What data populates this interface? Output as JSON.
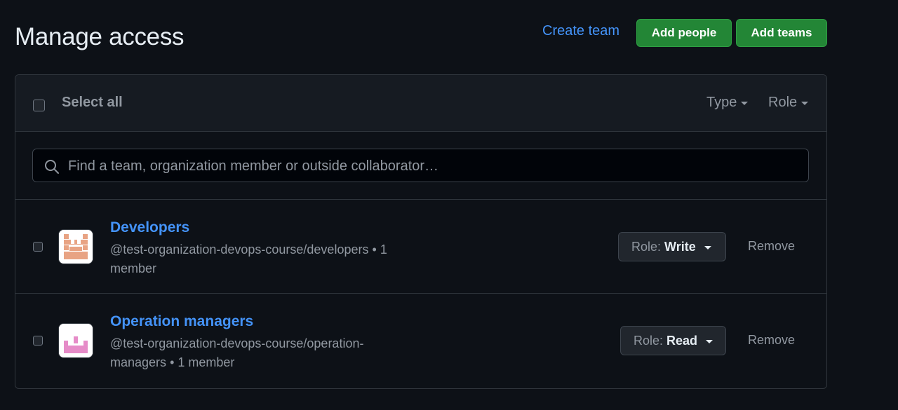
{
  "header": {
    "title": "Manage access",
    "create_team_label": "Create team",
    "add_people_label": "Add people",
    "add_teams_label": "Add teams"
  },
  "toolbar": {
    "select_all_label": "Select all",
    "filters": [
      {
        "label": "Type"
      },
      {
        "label": "Role"
      }
    ]
  },
  "search": {
    "placeholder": "Find a team, organization member or outside collaborator…",
    "value": ""
  },
  "teams": [
    {
      "name": "Developers",
      "slug": "@test-organization-devops-course/developers",
      "separator": "•",
      "member_count": "1 member",
      "role_prefix": "Role:",
      "role_value": "Write",
      "remove_label": "Remove",
      "avatar_color": "#e8a383"
    },
    {
      "name": "Operation managers",
      "slug": "@test-organization-devops-course/operation-managers",
      "separator": "•",
      "member_count": "1 member",
      "role_prefix": "Role:",
      "role_value": "Read",
      "remove_label": "Remove",
      "avatar_color": "#e68cc8"
    }
  ],
  "colors": {
    "background": "#0d1117",
    "accent_link": "#4493f8",
    "primary_button": "#238636"
  }
}
